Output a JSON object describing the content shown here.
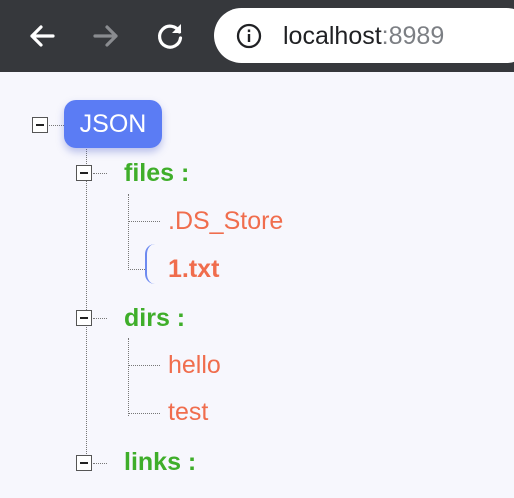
{
  "browser": {
    "url_host": "localhost",
    "url_port": ":8989",
    "icons": {
      "back": "back-arrow-icon",
      "forward": "forward-arrow-icon",
      "reload": "reload-icon",
      "info": "info-icon"
    }
  },
  "tree": {
    "root_label": "JSON",
    "nodes": {
      "files": {
        "label": "files :",
        "children": [
          ".DS_Store",
          "1.txt"
        ],
        "selected": "1.txt"
      },
      "dirs": {
        "label": "dirs :",
        "children": [
          "hello",
          "test"
        ]
      },
      "links": {
        "label": "links :"
      }
    }
  },
  "colors": {
    "root_pill": "#5b7cf4",
    "key_text": "#3fae2a",
    "leaf_text": "#f06d4d",
    "toolbar": "#36383c"
  }
}
